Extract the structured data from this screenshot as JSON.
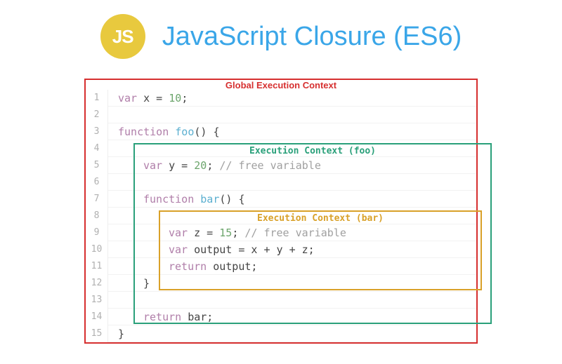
{
  "header": {
    "badge": "JS",
    "title": "JavaScript Closure (ES6)"
  },
  "labels": {
    "global": "Global Execution Context",
    "foo": "Execution Context (foo)",
    "bar": "Execution Context (bar)"
  },
  "code": {
    "line1_kw": "var",
    "line1_var": " x = ",
    "line1_num": "10",
    "line1_sc": ";",
    "line3_kw": "function",
    "line3_fn": " foo",
    "line3_rest": "() {",
    "line5_kw": "var",
    "line5_var": " y = ",
    "line5_num": "20",
    "line5_sc": "; ",
    "line5_cmt": "// free variable",
    "line7_kw": "function",
    "line7_fn": " bar",
    "line7_rest": "() {",
    "line9_kw": "var",
    "line9_var": " z = ",
    "line9_num": "15",
    "line9_sc": "; ",
    "line9_cmt": "// free variable",
    "line10_kw": "var",
    "line10_rest": " output = x + y + z;",
    "line11_kw": "return",
    "line11_rest": " output;",
    "line12": "}",
    "line14_kw": "return",
    "line14_rest": " bar;",
    "line15": "}"
  },
  "lineNumbers": [
    "1",
    "2",
    "3",
    "4",
    "5",
    "6",
    "7",
    "8",
    "9",
    "10",
    "11",
    "12",
    "13",
    "14",
    "15"
  ]
}
